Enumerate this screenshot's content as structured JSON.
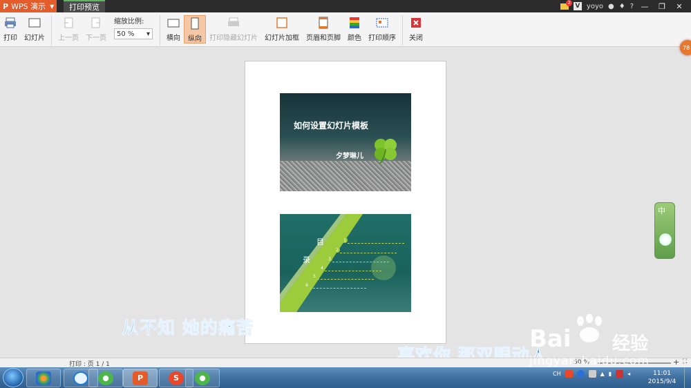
{
  "titlebar": {
    "app_name": "WPS 演示",
    "tab": "打印预览",
    "mail_badge": "2",
    "user": "yoyo",
    "user_logo": "V"
  },
  "toolbar": {
    "print": "打印",
    "slides": "幻灯片",
    "prev_page": "上一页",
    "next_page": "下一页",
    "zoom_label": "缩放比例:",
    "zoom_value": "50 %",
    "landscape": "横向",
    "portrait": "纵向",
    "print_hidden": "打印隐藏幻灯片",
    "slide_frame": "幻灯片加框",
    "header_footer": "页眉和页脚",
    "color": "颜色",
    "print_order": "打印顺序",
    "close": "关闭"
  },
  "slide1": {
    "title": "如何设置幻灯片模板",
    "author": "夕梦琳儿"
  },
  "slide2": {
    "mu": "目",
    "lu": "录",
    "items": [
      "1",
      "2",
      "3",
      "4",
      "5",
      "6"
    ]
  },
  "side_orb": "78",
  "ime": {
    "label": "中"
  },
  "lyrics": {
    "line1": "从不知  她的痛苦",
    "line2": "喜欢你  那双眼动人"
  },
  "status": {
    "page_info": "打印 : 页 1 / 1",
    "zoom": "50 %"
  },
  "watermark": {
    "brand": "Bai",
    "brand2": "经验",
    "url": "jingyan.baidu.com"
  },
  "taskbar": {
    "tray_lang": "CH",
    "time": "11:01",
    "date": "2015/9/4"
  },
  "colors": {
    "accent": "#e45c2b",
    "taskbar": "#3f6f9f",
    "slide_green": "#9ccc3c"
  }
}
